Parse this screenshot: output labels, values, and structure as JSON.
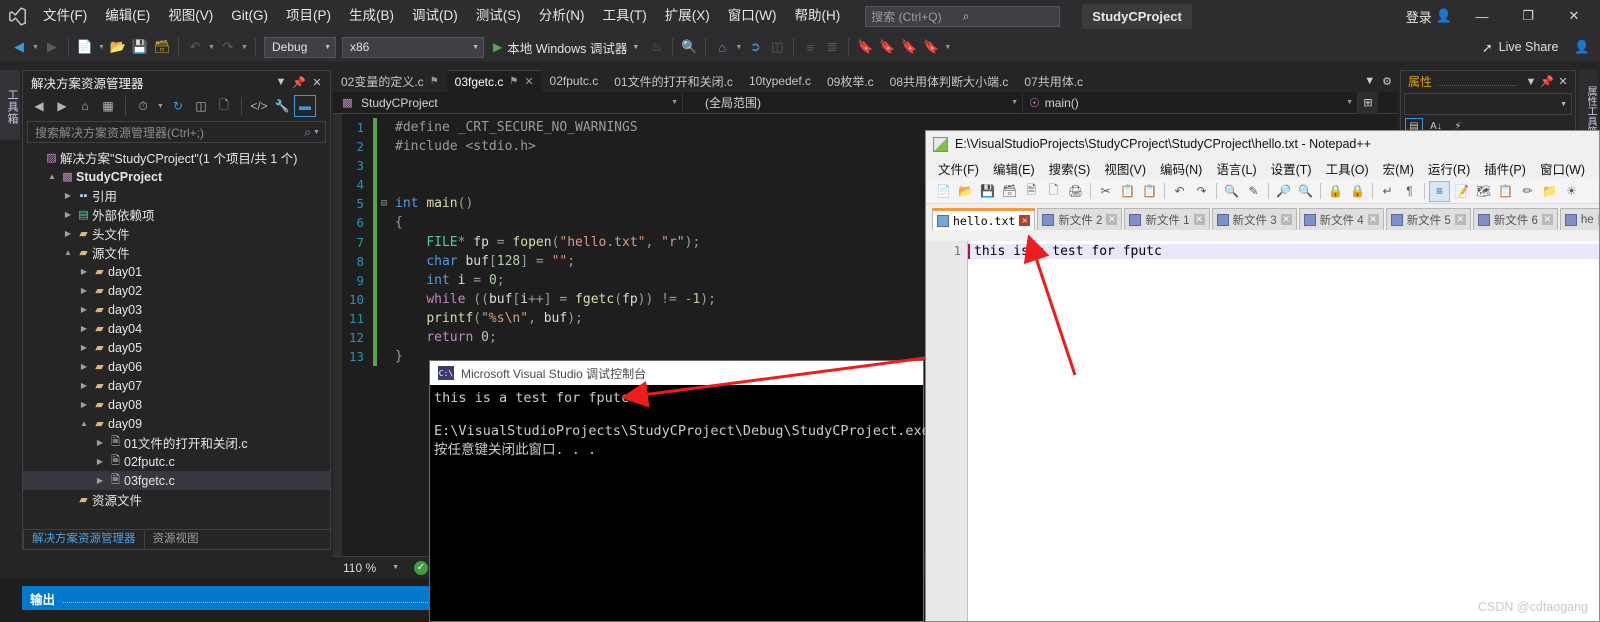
{
  "vs": {
    "menu": [
      "文件(F)",
      "编辑(E)",
      "视图(V)",
      "Git(G)",
      "项目(P)",
      "生成(B)",
      "调试(D)",
      "测试(S)",
      "分析(N)",
      "工具(T)",
      "扩展(X)",
      "窗口(W)",
      "帮助(H)"
    ],
    "search_placeholder": "搜索 (Ctrl+Q)",
    "project_badge": "StudyCProject",
    "signin_label": "登录",
    "window_buttons": {
      "minimize": "—",
      "maximize": "❐",
      "close": "✕"
    },
    "toolbar": {
      "config": "Debug",
      "platform": "x86",
      "run_label": "本地 Windows 调试器",
      "live_share": "Live Share"
    },
    "toolbox_tab": "工具箱",
    "solution_explorer": {
      "title": "解决方案资源管理器",
      "search_placeholder": "搜索解决方案资源管理器(Ctrl+;)",
      "tabs": [
        "解决方案资源管理器",
        "资源视图"
      ],
      "tree": [
        {
          "label": "解决方案\"StudyCProject\"(1 个项目/共 1 个)",
          "indent": 0,
          "twisty": "",
          "icon": "vs-solution-icon",
          "glyph": "▨",
          "iconclass": "vs",
          "bold": false,
          "selected": false
        },
        {
          "label": "StudyCProject",
          "indent": 1,
          "twisty": "▲",
          "icon": "project-icon",
          "glyph": "▩",
          "iconclass": "proj",
          "bold": true,
          "selected": false
        },
        {
          "label": "引用",
          "indent": 2,
          "twisty": "▶",
          "icon": "references-icon",
          "glyph": "▪▪",
          "iconclass": "ref",
          "bold": false,
          "selected": false
        },
        {
          "label": "外部依赖项",
          "indent": 2,
          "twisty": "▶",
          "icon": "external-dependencies-icon",
          "glyph": "▤",
          "iconclass": "ext",
          "bold": false,
          "selected": false
        },
        {
          "label": "头文件",
          "indent": 2,
          "twisty": "▶",
          "icon": "folder-icon",
          "glyph": "▰",
          "iconclass": "folder",
          "bold": false,
          "selected": false
        },
        {
          "label": "源文件",
          "indent": 2,
          "twisty": "▲",
          "icon": "folder-open-icon",
          "glyph": "▰",
          "iconclass": "folder",
          "bold": false,
          "selected": false
        },
        {
          "label": "day01",
          "indent": 3,
          "twisty": "▶",
          "icon": "folder-icon",
          "glyph": "▰",
          "iconclass": "folder",
          "bold": false,
          "selected": false
        },
        {
          "label": "day02",
          "indent": 3,
          "twisty": "▶",
          "icon": "folder-icon",
          "glyph": "▰",
          "iconclass": "folder",
          "bold": false,
          "selected": false
        },
        {
          "label": "day03",
          "indent": 3,
          "twisty": "▶",
          "icon": "folder-icon",
          "glyph": "▰",
          "iconclass": "folder",
          "bold": false,
          "selected": false
        },
        {
          "label": "day04",
          "indent": 3,
          "twisty": "▶",
          "icon": "folder-icon",
          "glyph": "▰",
          "iconclass": "folder",
          "bold": false,
          "selected": false
        },
        {
          "label": "day05",
          "indent": 3,
          "twisty": "▶",
          "icon": "folder-icon",
          "glyph": "▰",
          "iconclass": "folder",
          "bold": false,
          "selected": false
        },
        {
          "label": "day06",
          "indent": 3,
          "twisty": "▶",
          "icon": "folder-icon",
          "glyph": "▰",
          "iconclass": "folder",
          "bold": false,
          "selected": false
        },
        {
          "label": "day07",
          "indent": 3,
          "twisty": "▶",
          "icon": "folder-icon",
          "glyph": "▰",
          "iconclass": "folder",
          "bold": false,
          "selected": false
        },
        {
          "label": "day08",
          "indent": 3,
          "twisty": "▶",
          "icon": "folder-icon",
          "glyph": "▰",
          "iconclass": "folder",
          "bold": false,
          "selected": false
        },
        {
          "label": "day09",
          "indent": 3,
          "twisty": "▲",
          "icon": "folder-open-icon",
          "glyph": "▰",
          "iconclass": "folder",
          "bold": false,
          "selected": false
        },
        {
          "label": "01文件的打开和关闭.c",
          "indent": 4,
          "twisty": "▶",
          "icon": "c-file-icon",
          "glyph": "🗎",
          "iconclass": "cfile",
          "bold": false,
          "selected": false
        },
        {
          "label": "02fputc.c",
          "indent": 4,
          "twisty": "▶",
          "icon": "c-file-icon",
          "glyph": "🗎",
          "iconclass": "cfile",
          "bold": false,
          "selected": false
        },
        {
          "label": "03fgetc.c",
          "indent": 4,
          "twisty": "▶",
          "icon": "c-file-icon",
          "glyph": "🗎",
          "iconclass": "cfile",
          "bold": false,
          "selected": true
        },
        {
          "label": "资源文件",
          "indent": 2,
          "twisty": "",
          "icon": "folder-icon",
          "glyph": "▰",
          "iconclass": "folder",
          "bold": false,
          "selected": false
        }
      ]
    },
    "editor": {
      "tabs": [
        {
          "label": "02变量的定义.c",
          "active": false,
          "pinned": true
        },
        {
          "label": "03fgetc.c",
          "active": true,
          "pinned": true
        },
        {
          "label": "02fputc.c",
          "active": false,
          "pinned": false
        },
        {
          "label": "01文件的打开和关闭.c",
          "active": false,
          "pinned": false
        },
        {
          "label": "10typedef.c",
          "active": false,
          "pinned": false
        },
        {
          "label": "09枚举.c",
          "active": false,
          "pinned": false
        },
        {
          "label": "08共用体判断大小端.c",
          "active": false,
          "pinned": false
        },
        {
          "label": "07共用体.c",
          "active": false,
          "pinned": false
        }
      ],
      "nav": {
        "project": "StudyCProject",
        "scope": "(全局范围)",
        "symbol": "main()"
      },
      "zoom": "110 %",
      "lines": [
        {
          "n": 1,
          "changed": true,
          "fold": "",
          "html": "<span class=\"pp\">#define _CRT_SECURE_NO_WARNINGS</span>"
        },
        {
          "n": 2,
          "changed": true,
          "fold": "",
          "html": "<span class=\"pp\">#include &lt;stdio.h&gt;</span>"
        },
        {
          "n": 3,
          "changed": true,
          "fold": "",
          "html": ""
        },
        {
          "n": 4,
          "changed": true,
          "fold": "",
          "html": ""
        },
        {
          "n": 5,
          "changed": true,
          "fold": "−",
          "html": "<span class=\"k\">int</span> <span class=\"d\">main</span><span class=\"p\">()</span>"
        },
        {
          "n": 6,
          "changed": true,
          "fold": "",
          "html": "<span class=\"p\">{</span>"
        },
        {
          "n": 7,
          "changed": true,
          "fold": "",
          "html": "    <span class=\"t\">FILE</span><span class=\"p\">*</span> <span class=\"id\">fp</span> <span class=\"p\">=</span> <span class=\"d\">fopen</span><span class=\"p\">(</span><span class=\"s\">\"hello.txt\"</span><span class=\"p\">,</span> <span class=\"s\">\"r\"</span><span class=\"p\">);</span>"
        },
        {
          "n": 8,
          "changed": true,
          "fold": "",
          "html": "    <span class=\"k\">char</span> <span class=\"id\">buf</span><span class=\"p\">[</span><span class=\"n\">128</span><span class=\"p\">]</span> <span class=\"p\">=</span> <span class=\"s\">\"\"</span><span class=\"p\">;</span>"
        },
        {
          "n": 9,
          "changed": true,
          "fold": "",
          "html": "    <span class=\"k\">int</span> <span class=\"id\">i</span> <span class=\"p\">=</span> <span class=\"n\">0</span><span class=\"p\">;</span>"
        },
        {
          "n": 10,
          "changed": true,
          "fold": "",
          "html": "    <span class=\"k2\">while</span> <span class=\"p\">((</span><span class=\"id\">buf</span><span class=\"p\">[</span><span class=\"id\">i</span><span class=\"p\">++]</span> <span class=\"p\">=</span> <span class=\"d\">fgetc</span><span class=\"p\">(</span><span class=\"id\">fp</span><span class=\"p\">))</span> <span class=\"p\">!=</span> <span class=\"p\">-</span><span class=\"n\">1</span><span class=\"p\">);</span>"
        },
        {
          "n": 11,
          "changed": true,
          "fold": "",
          "html": "    <span class=\"d\">printf</span><span class=\"p\">(</span><span class=\"s\">\"%s\\n\"</span><span class=\"p\">,</span> <span class=\"id\">buf</span><span class=\"p\">);</span>"
        },
        {
          "n": 12,
          "changed": true,
          "fold": "",
          "html": "    <span class=\"k2\">return</span> <span class=\"n\">0</span><span class=\"p\">;</span>"
        },
        {
          "n": 13,
          "changed": true,
          "fold": "",
          "html": "<span class=\"p\">}</span>"
        }
      ]
    },
    "properties": {
      "title": "属性"
    },
    "toolbox_right_tab": "属性工具箱",
    "output_panel": {
      "label": "输出"
    }
  },
  "console": {
    "title": "Microsoft Visual Studio 调试控制台",
    "icon_text": "C:\\",
    "lines": [
      "this is a test for fputc",
      "",
      "E:\\VisualStudioProjects\\StudyCProject\\Debug\\StudyCProject.exe (",
      "按任意键关闭此窗口. . ."
    ]
  },
  "notepad": {
    "title": "E:\\VisualStudioProjects\\StudyCProject\\StudyCProject\\hello.txt - Notepad++",
    "menu": [
      "文件(F)",
      "编辑(E)",
      "搜索(S)",
      "视图(V)",
      "编码(N)",
      "语言(L)",
      "设置(T)",
      "工具(O)",
      "宏(M)",
      "运行(R)",
      "插件(P)",
      "窗口(W)",
      "?"
    ],
    "tabs": [
      {
        "label": "hello.txt",
        "active": true
      },
      {
        "label": "新文件 2",
        "active": false
      },
      {
        "label": "新文件 1",
        "active": false
      },
      {
        "label": "新文件 3",
        "active": false
      },
      {
        "label": "新文件 4",
        "active": false
      },
      {
        "label": "新文件 5",
        "active": false
      },
      {
        "label": "新文件 6",
        "active": false
      },
      {
        "label": "he",
        "active": false
      }
    ],
    "line_number": "1",
    "content": "this is a test for fputc"
  },
  "watermark": "CSDN @cdtaogang",
  "colors": {
    "accent": "#007acc",
    "vs_bg": "#1e1e1e",
    "vs_chrome": "#2d2d30",
    "arrow_red": "#ee1c1c",
    "npp_tab_active": "#f29c3d"
  }
}
